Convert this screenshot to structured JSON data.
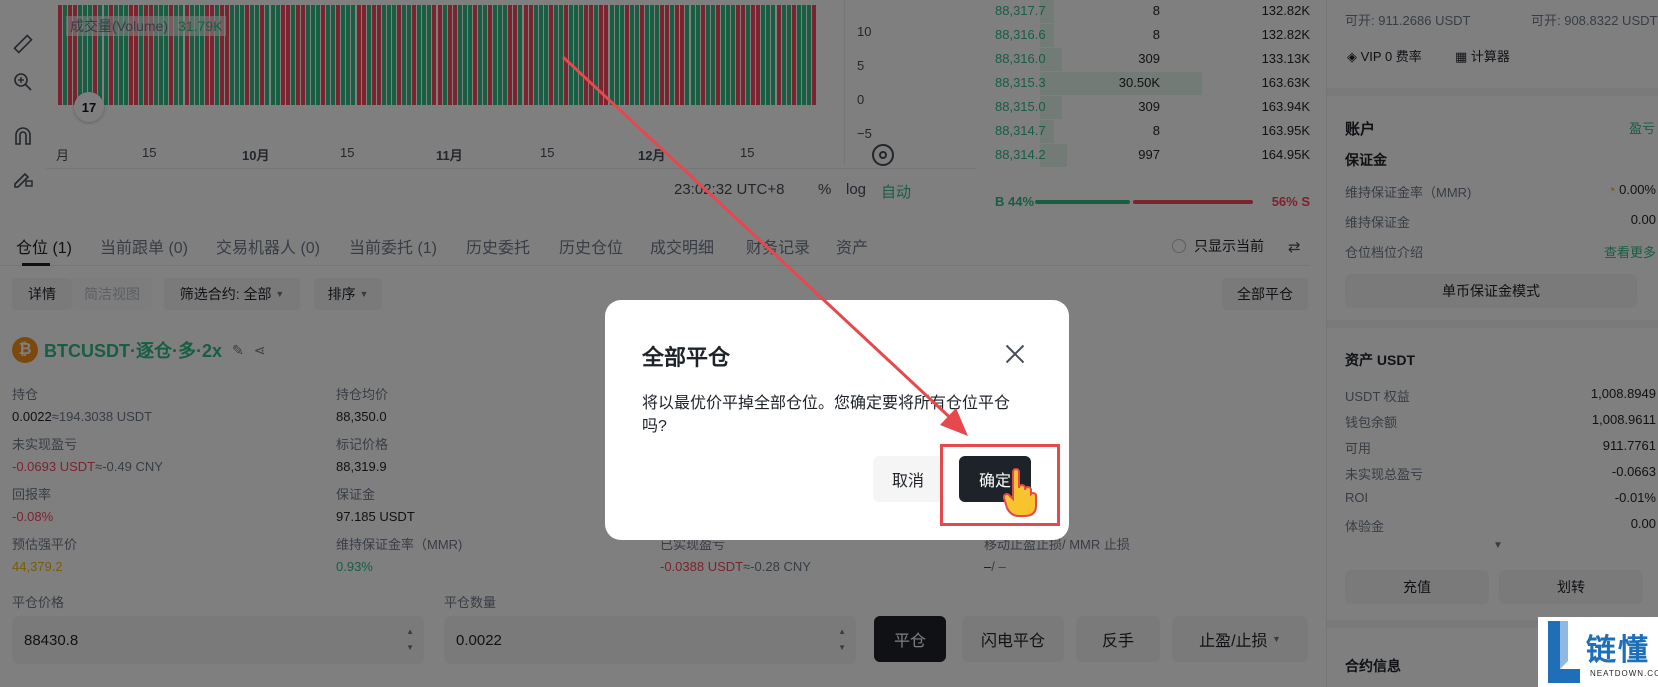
{
  "chart": {
    "volume_label": "成交量(Volume)",
    "volume_value": "31.79K",
    "x_ticks": [
      {
        "label": "月",
        "bold": false
      },
      {
        "label": "15",
        "bold": false
      },
      {
        "label": "10月",
        "bold": true
      },
      {
        "label": "15",
        "bold": false
      },
      {
        "label": "11月",
        "bold": true
      },
      {
        "label": "15",
        "bold": false
      },
      {
        "label": "12月",
        "bold": true
      },
      {
        "label": "15",
        "bold": false
      }
    ],
    "y_ticks": [
      "10",
      "5",
      "0",
      "−5"
    ],
    "time": "23:02:32 UTC+8",
    "percent_label": "%",
    "log_label": "log",
    "auto_label": "自动",
    "volume_colors": {
      "up": "#2ebd85",
      "down": "#f6465d"
    }
  },
  "orderbook": {
    "rows": [
      {
        "price": "88,317.7",
        "qty": "8",
        "total": "132.82K",
        "depth": 0.05
      },
      {
        "price": "88,316.6",
        "qty": "8",
        "total": "132.82K",
        "depth": 0.05
      },
      {
        "price": "88,316.0",
        "qty": "309",
        "total": "133.13K",
        "depth": 0.08
      },
      {
        "price": "88,315.3",
        "qty": "30.50K",
        "total": "163.63K",
        "depth": 0.6
      },
      {
        "price": "88,315.0",
        "qty": "309",
        "total": "163.94K",
        "depth": 0.08
      },
      {
        "price": "88,314.7",
        "qty": "8",
        "total": "163.95K",
        "depth": 0.05
      },
      {
        "price": "88,314.2",
        "qty": "997",
        "total": "164.95K",
        "depth": 0.1
      }
    ],
    "buy_ratio": "B 44%",
    "sell_ratio": "56% S"
  },
  "right_panel": {
    "open_long": "可开: 911.2686 USDT",
    "open_short": "可开: 908.8322 USDT",
    "vip": "VIP 0 费率",
    "calculator": "计算器",
    "account_title": "账户",
    "pnl_link": "盈亏",
    "margin_title": "保证金",
    "mmr_label": "维持保证金率（MMR)",
    "mmr_value": "0.00%",
    "maint_margin_label": "维持保证金",
    "maint_margin_value": "0.00",
    "tier_label": "仓位档位介绍",
    "view_more": "查看更多",
    "single_margin_btn": "单币保证金模式",
    "assets_title": "资产 USDT",
    "assets": [
      {
        "label": "USDT 权益",
        "value": "1,008.8949"
      },
      {
        "label": "钱包余额",
        "value": "1,008.9611"
      },
      {
        "label": "可用",
        "value": "911.7761"
      },
      {
        "label": "未实现总盈亏",
        "value": "-0.0663"
      },
      {
        "label": "ROI",
        "value": "-0.01%"
      },
      {
        "label": "体验金",
        "value": "0.00"
      }
    ],
    "deposit_btn": "充值",
    "transfer_btn": "划转",
    "contract_info": "合约信息"
  },
  "tabs": [
    {
      "label": "仓位 (1)",
      "active": true
    },
    {
      "label": "当前跟单 (0)",
      "active": false
    },
    {
      "label": "交易机器人 (0)",
      "active": false
    },
    {
      "label": "当前委托 (1)",
      "active": false
    },
    {
      "label": "历史委托",
      "active": false
    },
    {
      "label": "历史仓位",
      "active": false
    },
    {
      "label": "成交明细",
      "active": false
    },
    {
      "label": "财务记录",
      "active": false
    },
    {
      "label": "资产",
      "active": false
    }
  ],
  "only_current": "只显示当前",
  "filters": {
    "detail": "详情",
    "compact": "简洁视图",
    "contract_filter_label": "筛选合约:",
    "contract_filter_value": "全部",
    "sort": "排序",
    "close_all": "全部平仓"
  },
  "position": {
    "symbol": "BTCUSDT·逐仓·多·2x",
    "fields": [
      {
        "label": "持仓",
        "value": "0.0022",
        "suffix": "≈194.3038 USDT",
        "style": ""
      },
      {
        "label": "持仓均价",
        "value": "88,350.0",
        "suffix": "",
        "style": ""
      },
      {
        "label": "未实现盈亏",
        "value": "-0.0693 USDT",
        "suffix": "≈-0.49 CNY",
        "style": "red"
      },
      {
        "label": "标记价格",
        "value": "88,319.9",
        "suffix": "",
        "style": ""
      },
      {
        "label": "回报率",
        "value": "-0.08%",
        "suffix": "",
        "style": "red"
      },
      {
        "label": "保证金",
        "value": "97.185 USDT",
        "suffix": "",
        "style": ""
      },
      {
        "label": "预估强平价",
        "value": "44,379.2",
        "suffix": "",
        "style": "orange"
      },
      {
        "label": "维持保证金率（MMR)",
        "value": "0.93%",
        "suffix": "",
        "style": "green"
      },
      {
        "label": "已实现盈亏",
        "value": "-0.0388 USDT",
        "suffix": "≈-0.28 CNY",
        "style": "red"
      },
      {
        "label": "移动止盈止损/ MMR 止损",
        "value": "–",
        "suffix": "/ –",
        "style": ""
      }
    ],
    "close_price_label": "平仓价格",
    "close_price_value": "88430.8",
    "close_qty_label": "平仓数量",
    "close_qty_value": "0.0022",
    "close_btn": "平仓",
    "flash_close_btn": "闪电平仓",
    "reverse_btn": "反手",
    "tpsl_btn": "止盈/止损"
  },
  "modal": {
    "title": "全部平仓",
    "message": "将以最优价平掉全部仓位。您确定要将所有仓位平仓吗?",
    "cancel": "取消",
    "confirm": "确定"
  },
  "annotation_color": "#e5484d",
  "watermark": {
    "text": "链懂",
    "sub": "NEATDOWN.COM"
  }
}
